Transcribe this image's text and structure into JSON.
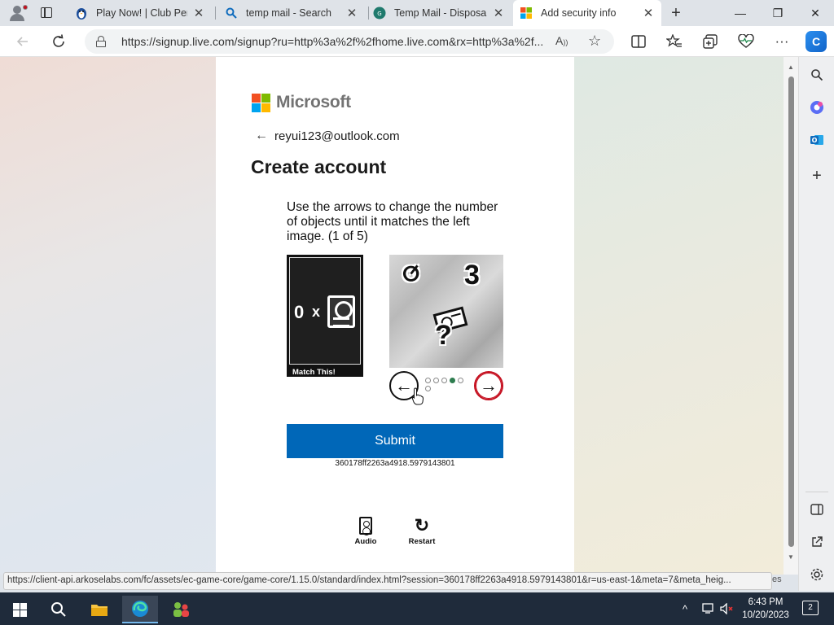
{
  "browser": {
    "tabs": [
      {
        "title": "Play Now! | Club Penguin",
        "close": "✕"
      },
      {
        "title": "temp mail - Search",
        "close": "✕"
      },
      {
        "title": "Temp Mail - Disposable",
        "close": "✕"
      },
      {
        "title": "Add security info",
        "close": "✕",
        "active": true
      }
    ],
    "new_tab": "+",
    "window_controls": {
      "minimize": "—",
      "restore": "❐",
      "close": "✕"
    },
    "url": "https://signup.live.com/signup?ru=http%3a%2f%2fhome.live.com&rx=http%3a%2f...",
    "read_aloud": "Á",
    "copilot": "C"
  },
  "page": {
    "brand": "Microsoft",
    "brand_colors": [
      "#f25022",
      "#7fba00",
      "#00a4ef",
      "#ffb900"
    ],
    "email": "reyui123@outlook.com",
    "back_arrow": "←",
    "title": "Create account",
    "instruction": "Use the arrows to change the number of objects until it matches the left image. (1 of 5)",
    "match_image": {
      "count": "0",
      "times": "x",
      "label": "Match This!"
    },
    "puzzle_glyphs": [
      "ⵚ",
      "3",
      "?"
    ],
    "arrows": {
      "left": "←",
      "right": "→"
    },
    "dots": {
      "total": 6,
      "active_index": 3
    },
    "submit_label": "Submit",
    "session_id": "360178ff2263a4918.5979143801",
    "tools": {
      "audio": "Audio",
      "restart": "Restart",
      "restart_icon": "↻"
    }
  },
  "status_url": "https://client-api.arkoselabs.com/fc/assets/ec-game-core/game-core/1.15.0/standard/index.html?session=360178ff2263a4918.5979143801&r=us-east-1&meta=7&meta_heig...",
  "status_tail": "es",
  "taskbar": {
    "time": "6:43 PM",
    "date": "10/20/2023",
    "notification_count": "2"
  }
}
